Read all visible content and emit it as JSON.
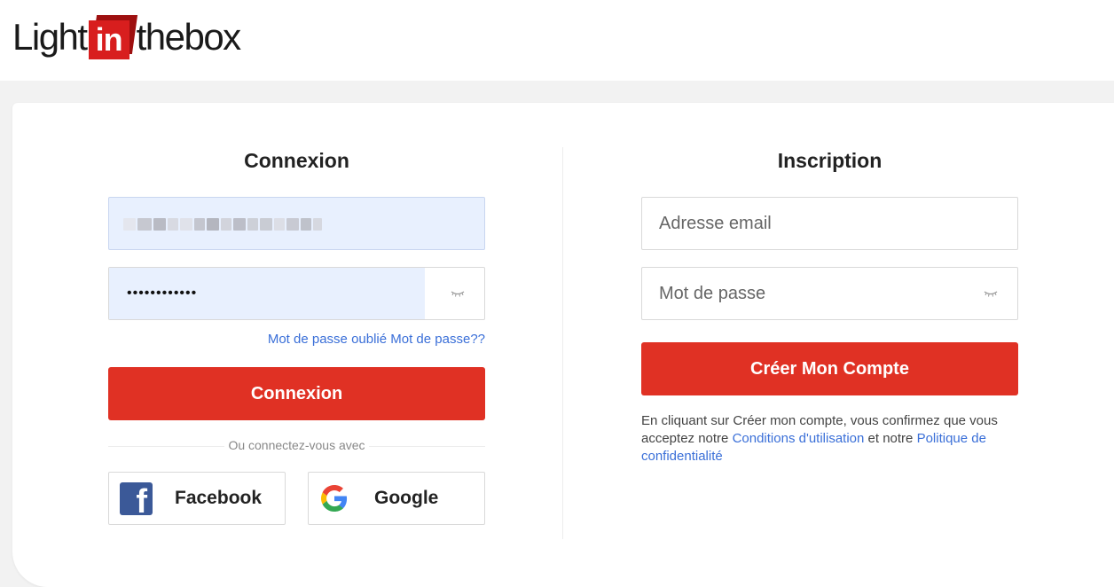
{
  "header": {
    "logo_left": "Light",
    "logo_box": "in",
    "logo_right": "thebox"
  },
  "login": {
    "title": "Connexion",
    "email_value_masked": "",
    "password_value": "••••••••••••",
    "forgot_link": "Mot de passe oublié Mot de passe??",
    "submit_label": "Connexion",
    "or_text": "Ou connectez-vous avec",
    "facebook_label": "Facebook",
    "google_label": "Google"
  },
  "register": {
    "title": "Inscription",
    "email_placeholder": "Adresse email",
    "password_placeholder": "Mot de passe",
    "submit_label": "Créer Mon Compte",
    "terms_prefix": "En cliquant sur Créer mon compte, vous confirmez que vous acceptez notre ",
    "terms_link": "Conditions d'utilisation",
    "terms_middle": " et notre ",
    "privacy_link": "Politique de confidentialité"
  },
  "colors": {
    "primary_button": "#e03124",
    "link": "#3a6fd8",
    "autofill": "#e8f0fe",
    "facebook": "#3b5998"
  },
  "icons": {
    "password_toggle": "eye-closed-icon",
    "facebook": "facebook-icon",
    "google": "google-icon"
  }
}
